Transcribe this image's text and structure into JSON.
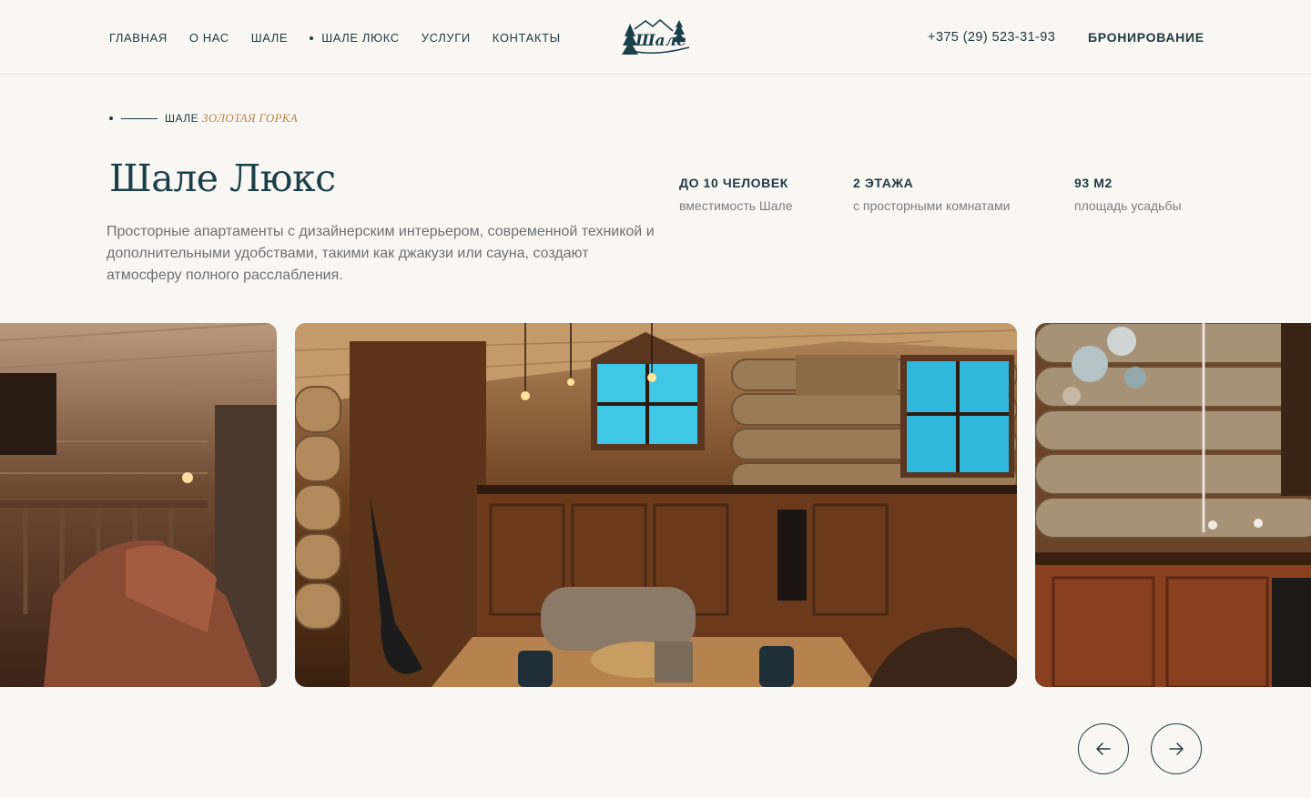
{
  "nav": {
    "items": [
      {
        "label": "ГЛАВНАЯ",
        "active": false
      },
      {
        "label": "О НАС",
        "active": false
      },
      {
        "label": "ШАЛЕ",
        "active": false
      },
      {
        "label": "ШАЛЕ ЛЮКС",
        "active": true
      },
      {
        "label": "УСЛУГИ",
        "active": false
      },
      {
        "label": "КОНТАКТЫ",
        "active": false
      }
    ]
  },
  "logo": {
    "text": "Шале",
    "icon": "fir-tree-logo"
  },
  "header": {
    "phone": "+375 (29) 523-31-93",
    "booking_label": "БРОНИРОВАНИЕ"
  },
  "breadcrumb": {
    "section": "ШАЛЕ",
    "location": "ЗОЛОТАЯ ГОРКА"
  },
  "page": {
    "title": "Шале Люкс",
    "description": "Просторные апартаменты с дизайнерским интерьером, современной техникой и дополнительными удобствами, такими как джакузи или сауна, создают атмосферу полного расслабления."
  },
  "stats": [
    {
      "value": "ДО 10 ЧЕЛОВЕК",
      "label": "вместимость Шале"
    },
    {
      "value": "2 ЭТАЖА",
      "label": "с просторными комнатами"
    },
    {
      "value": "93 М2",
      "label": "площадь усадьбы"
    }
  ],
  "gallery": {
    "slides": [
      {
        "subject": "living-room-sofa"
      },
      {
        "subject": "kitchen-dining"
      },
      {
        "subject": "kitchen-wall"
      }
    ],
    "prev_icon": "arrow-left-icon",
    "next_icon": "arrow-right-icon"
  },
  "colors": {
    "background": "#f9f7f3",
    "primary": "#1f3a40",
    "accent": "#b8844a",
    "muted": "#6d7072",
    "wood": "#7a4a26"
  }
}
